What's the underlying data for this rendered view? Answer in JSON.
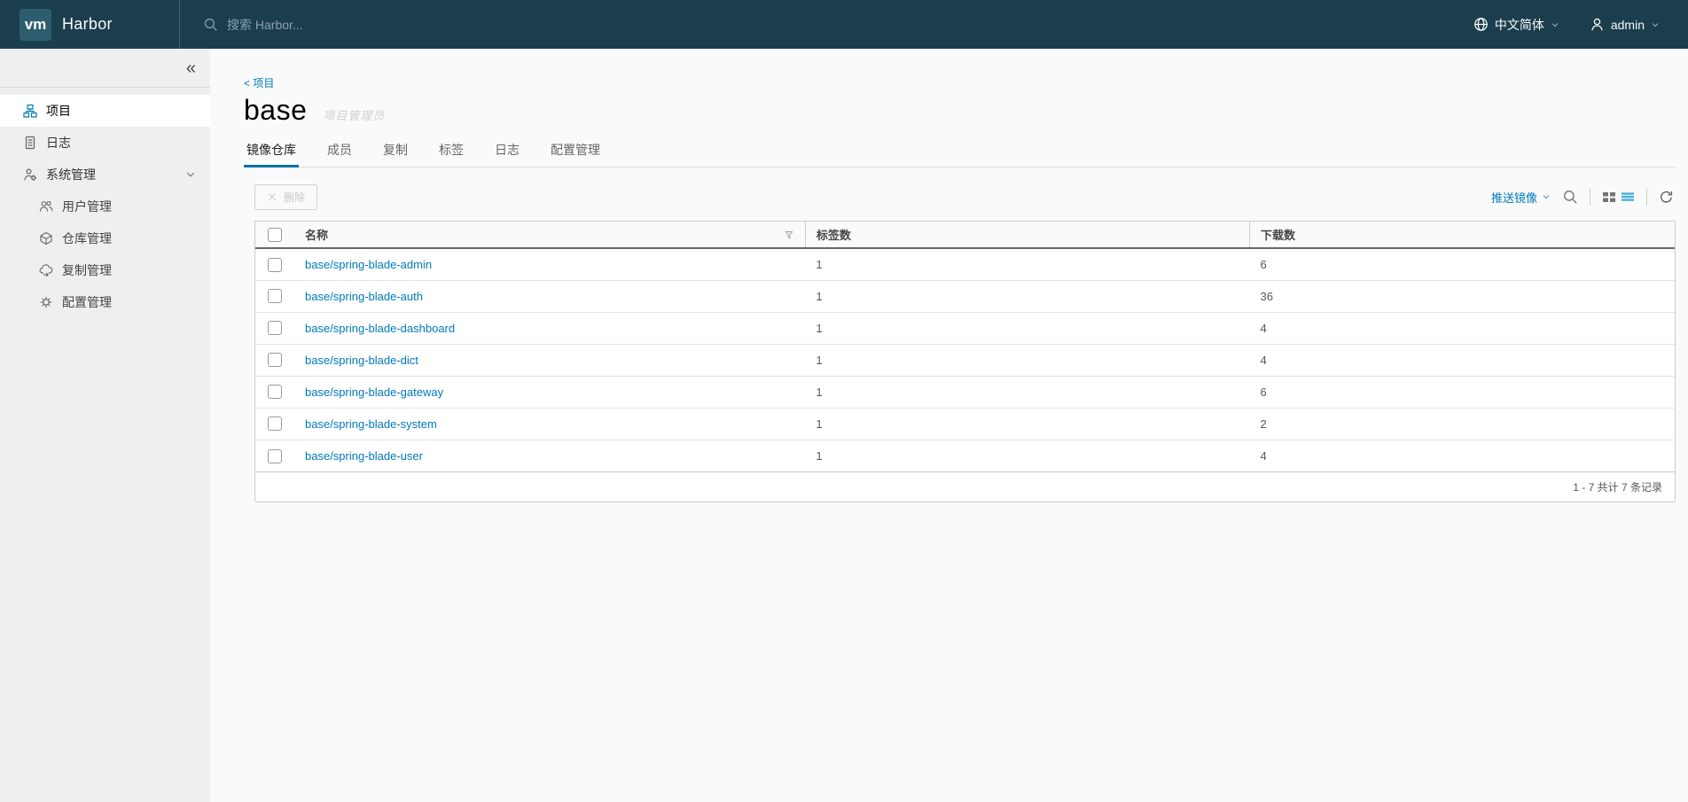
{
  "header": {
    "logo_text": "vm",
    "app_name": "Harbor",
    "search_placeholder": "搜索 Harbor...",
    "language_label": "中文简体",
    "user_label": "admin"
  },
  "icons": {
    "collapse": "«"
  },
  "sidebar": {
    "items": [
      {
        "label": "项目",
        "active": true
      },
      {
        "label": "日志",
        "active": false
      },
      {
        "label": "系统管理",
        "active": false,
        "expanded": true
      }
    ],
    "subitems": [
      {
        "label": "用户管理"
      },
      {
        "label": "仓库管理"
      },
      {
        "label": "复制管理"
      },
      {
        "label": "配置管理"
      }
    ]
  },
  "main": {
    "breadcrumb": "< 项目",
    "title": "base",
    "role_badge": "项目管理员",
    "tabs": [
      {
        "label": "镜像仓库",
        "active": true
      },
      {
        "label": "成员",
        "active": false
      },
      {
        "label": "复制",
        "active": false
      },
      {
        "label": "标签",
        "active": false
      },
      {
        "label": "日志",
        "active": false
      },
      {
        "label": "配置管理",
        "active": false
      }
    ],
    "toolbar": {
      "delete_label": "删除",
      "push_image_label": "推送镜像"
    },
    "table": {
      "columns": {
        "name": "名称",
        "tags": "标签数",
        "downloads": "下载数"
      },
      "rows": [
        {
          "name": "base/spring-blade-admin",
          "tags": "1",
          "downloads": "6"
        },
        {
          "name": "base/spring-blade-auth",
          "tags": "1",
          "downloads": "36"
        },
        {
          "name": "base/spring-blade-dashboard",
          "tags": "1",
          "downloads": "4"
        },
        {
          "name": "base/spring-blade-dict",
          "tags": "1",
          "downloads": "4"
        },
        {
          "name": "base/spring-blade-gateway",
          "tags": "1",
          "downloads": "6"
        },
        {
          "name": "base/spring-blade-system",
          "tags": "1",
          "downloads": "2"
        },
        {
          "name": "base/spring-blade-user",
          "tags": "1",
          "downloads": "4"
        }
      ],
      "footer_text": "1 - 7 共计 7 条记录"
    }
  },
  "colors": {
    "header_bg": "#1b3e4e",
    "logo_bg": "#2e5d70",
    "link_blue": "#0079b8",
    "active_tab_underline": "#0072a3",
    "list_view_icon_blue": "#49afd9"
  }
}
